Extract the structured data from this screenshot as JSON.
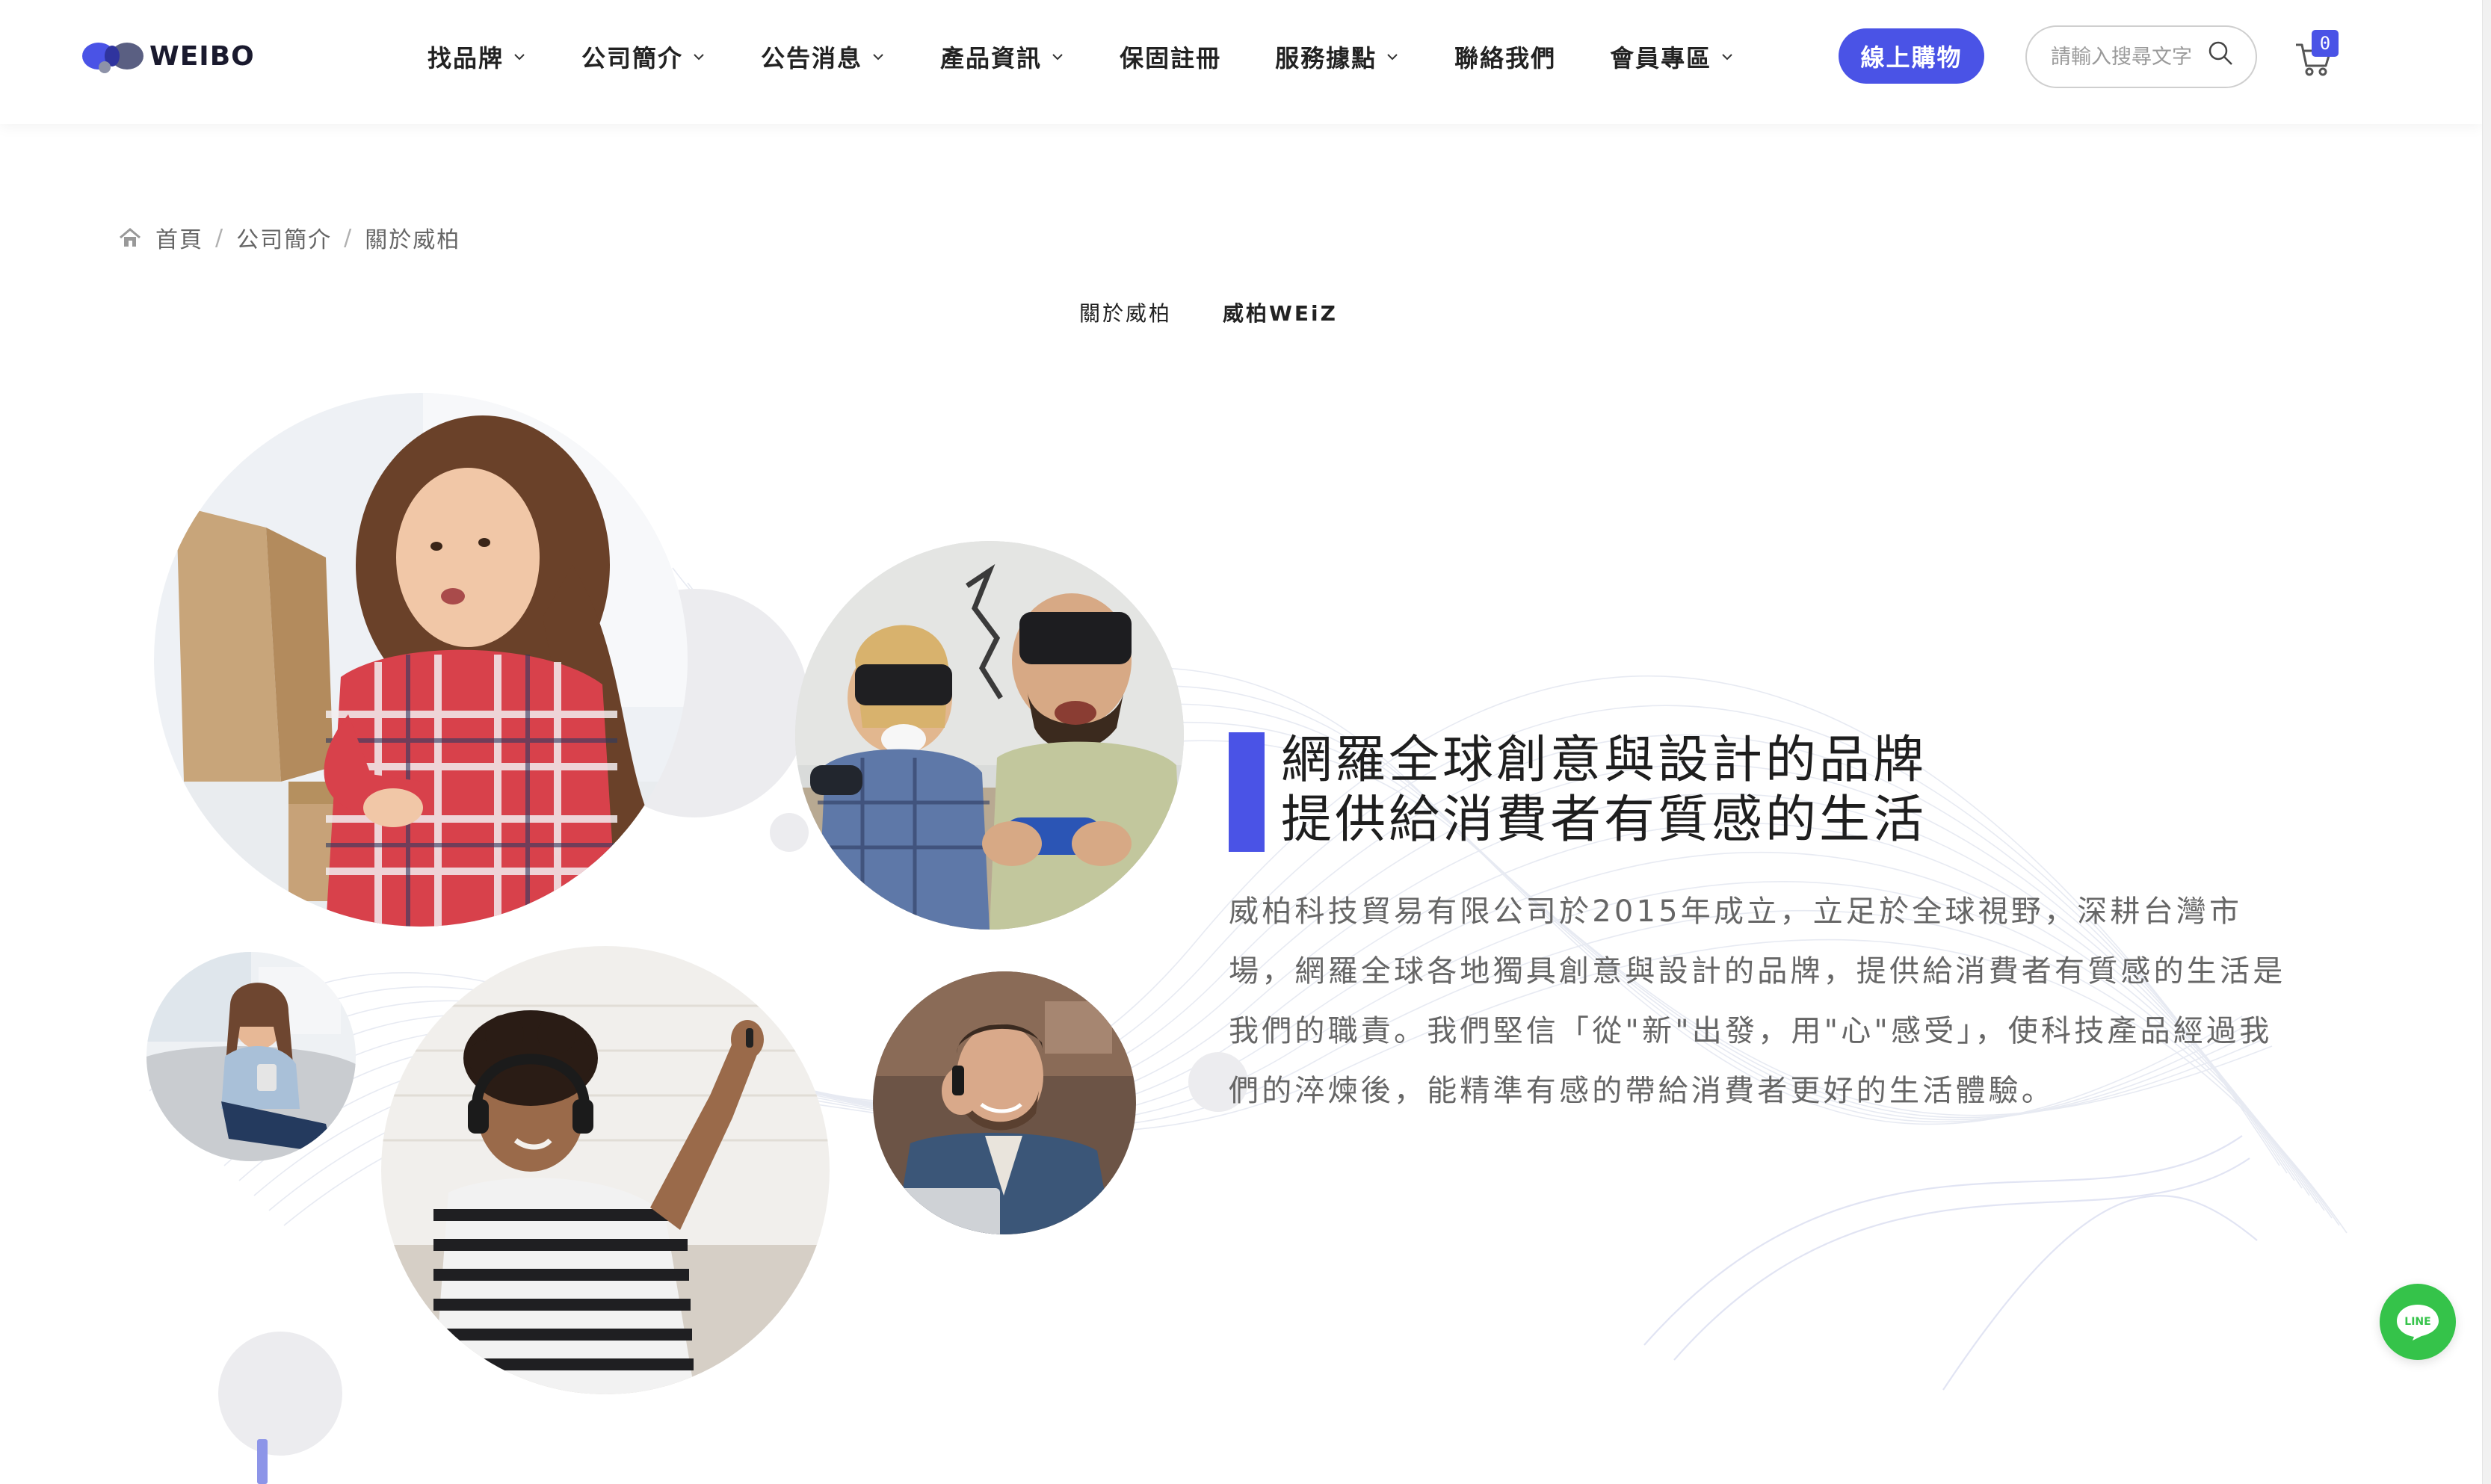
{
  "brand": {
    "logo_text": "WEIBO",
    "accent_color": "#4a53e6",
    "line_color": "#35c34a"
  },
  "nav": {
    "items": [
      {
        "label": "找品牌",
        "has_dropdown": true
      },
      {
        "label": "公司簡介",
        "has_dropdown": true
      },
      {
        "label": "公告消息",
        "has_dropdown": true
      },
      {
        "label": "產品資訊",
        "has_dropdown": true
      },
      {
        "label": "保固註冊",
        "has_dropdown": false
      },
      {
        "label": "服務據點",
        "has_dropdown": true
      },
      {
        "label": "聯絡我們",
        "has_dropdown": false
      },
      {
        "label": "會員專區",
        "has_dropdown": true
      }
    ],
    "buy_label": "線上購物",
    "search_placeholder": "請輸入搜尋文字",
    "cart_count": "0"
  },
  "breadcrumb": {
    "home": "首頁",
    "section": "公司簡介",
    "current": "關於威柏",
    "separator": "/"
  },
  "subtabs": [
    "關於威柏",
    "威柏WEiZ"
  ],
  "about": {
    "headline_line1": "網羅全球創意與設計的品牌",
    "headline_line2": "提供給消費者有質感的生活",
    "description": "威柏科技貿易有限公司於2015年成立，立足於全球視野，深耕台灣市場，網羅全球各地獨具創意與設計的品牌，提供給消費者有質感的生活是我們的職責。我們堅信「從\"新\"出發，用\"心\"感受」，使科技產品經過我們的淬煉後，能精準有感的帶給消費者更好的生活體驗。"
  },
  "photos": {
    "girl_box": "girl-opening-box-photo",
    "vr_couple": "vr-gaming-couple-photo",
    "woman_sofa": "woman-on-sofa-photo",
    "man_headphones": "man-with-headphones-photo",
    "man_phone": "man-on-phone-photo"
  },
  "floating": {
    "line_label": "LINE"
  }
}
